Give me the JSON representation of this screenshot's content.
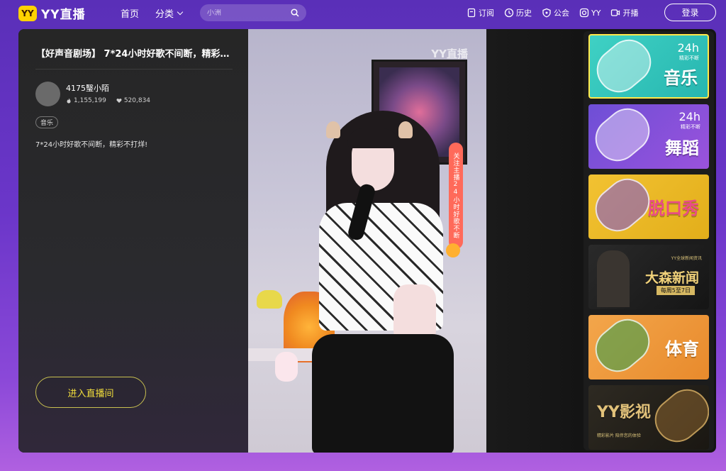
{
  "header": {
    "logo_badge": "YY",
    "logo_text": "YY直播",
    "nav_home": "首页",
    "nav_category": "分类",
    "search_placeholder": "小洲",
    "links": [
      {
        "label": "订阅",
        "icon": "bookmark-icon"
      },
      {
        "label": "历史",
        "icon": "clock-icon"
      },
      {
        "label": "公会",
        "icon": "shield-icon"
      },
      {
        "label": "YY",
        "icon": "instagram-icon"
      },
      {
        "label": "开播",
        "icon": "video-camera-icon"
      }
    ],
    "login_label": "登录"
  },
  "room": {
    "title": "【好声音剧场】 7*24小时好歌不间断，精彩不...",
    "anchor_name": "4175瑿小陌",
    "heat": "1,155,199",
    "likes": "520,834",
    "tag": "音乐",
    "description": "7*24小时好歌不间断，精彩不打烊!",
    "enter_label": "进入直播间"
  },
  "video": {
    "watermark": "YY直播",
    "banner_text": "关注主播24小时好歌不断"
  },
  "categories": [
    {
      "title": "音乐",
      "sub_big": "24h",
      "sub_small": "精彩不断",
      "active": true
    },
    {
      "title": "舞蹈",
      "sub_big": "24h",
      "sub_small": "精彩不断",
      "active": false
    },
    {
      "title": "脱口秀",
      "active": false
    },
    {
      "title": "大森新闻",
      "sub_top": "YY全球新闻资讯",
      "date": "每周5至7日",
      "active": false
    },
    {
      "title": "体育",
      "active": false
    },
    {
      "title": "YY影视",
      "sub_bottom": "精彩影片 陪伴您的体验",
      "active": false
    }
  ]
}
